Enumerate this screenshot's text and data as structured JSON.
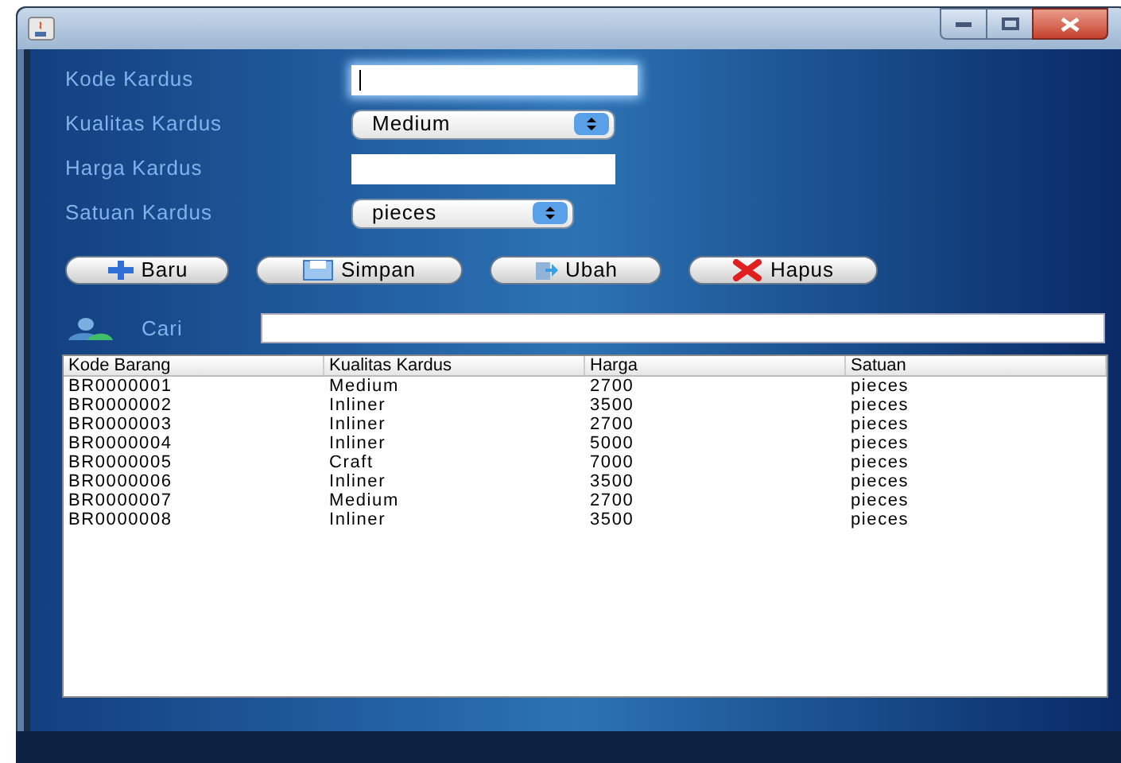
{
  "form": {
    "fields": [
      {
        "label": "Kode Kardus",
        "kind": "text",
        "focused": true
      },
      {
        "label": "Kualitas Kardus",
        "kind": "combo",
        "value": "Medium"
      },
      {
        "label": "Harga Kardus",
        "kind": "text",
        "focused": false
      },
      {
        "label": "Satuan Kardus",
        "kind": "combo",
        "value": "pieces"
      }
    ]
  },
  "buttons": [
    {
      "label": "Baru",
      "kind": "plus"
    },
    {
      "label": "Simpan",
      "kind": "save"
    },
    {
      "label": "Ubah",
      "kind": "edit"
    },
    {
      "label": "Hapus",
      "kind": "delete"
    }
  ],
  "search": {
    "label": "Cari"
  },
  "table": {
    "columns": [
      "Kode Barang",
      "Kualitas Kardus",
      "Harga",
      "Satuan"
    ],
    "rows": [
      [
        "BR0000001",
        "Medium",
        "2700",
        "pieces"
      ],
      [
        "BR0000002",
        "Inliner",
        "3500",
        "pieces"
      ],
      [
        "BR0000003",
        "Inliner",
        "2700",
        "pieces"
      ],
      [
        "BR0000004",
        "Inliner",
        "5000",
        "pieces"
      ],
      [
        "BR0000005",
        "Craft",
        "7000",
        "pieces"
      ],
      [
        "BR0000006",
        "Inliner",
        "3500",
        "pieces"
      ],
      [
        "BR0000007",
        "Medium",
        "2700",
        "pieces"
      ],
      [
        "BR0000008",
        "Inliner",
        "3500",
        "pieces"
      ]
    ]
  }
}
